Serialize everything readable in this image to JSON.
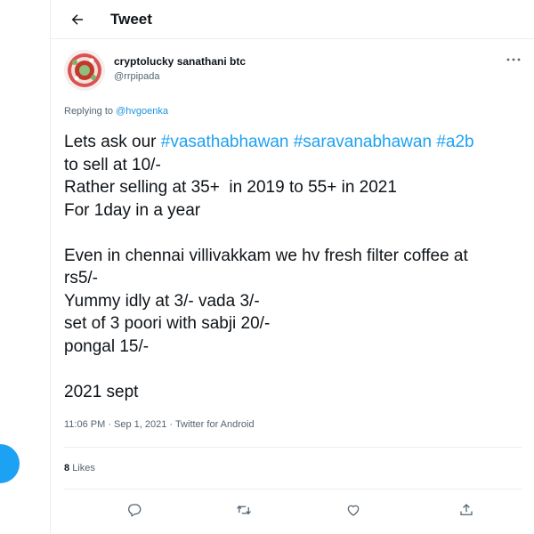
{
  "header": {
    "title": "Tweet"
  },
  "icons": {
    "back": "arrow-left-icon",
    "more": "more-dots-icon",
    "reply": "comment-icon",
    "retweet": "retweet-icon",
    "like": "heart-icon",
    "share": "share-icon"
  },
  "colors": {
    "accent": "#1da1f2",
    "link": "#1b95e0",
    "text": "#0f1419",
    "muted": "#536471",
    "border": "#ebeef0"
  },
  "tweet": {
    "author": {
      "display_name": "cryptolucky sanathani btc",
      "handle": "@rrpipada"
    },
    "replying_to": {
      "prefix": "Replying to",
      "handle": "@hvgoenka"
    },
    "lines": [
      {
        "parts": [
          {
            "text": "Lets ask our ",
            "hashtag": false
          },
          {
            "text": "#vasathabhawan",
            "hashtag": true
          },
          {
            "text": " ",
            "hashtag": false
          },
          {
            "text": "#saravanabhawan",
            "hashtag": true
          },
          {
            "text": " ",
            "hashtag": false
          },
          {
            "text": "#a2b",
            "hashtag": true
          }
        ]
      },
      {
        "parts": [
          {
            "text": "to sell at 10/-",
            "hashtag": false
          }
        ]
      },
      {
        "parts": [
          {
            "text": "Rather selling at 35+  in 2019 to 55+ in 2021",
            "hashtag": false
          }
        ]
      },
      {
        "parts": [
          {
            "text": "For 1day in a year",
            "hashtag": false
          }
        ]
      },
      {
        "parts": []
      },
      {
        "parts": [
          {
            "text": "Even in chennai villivakkam we hv fresh filter coffee at",
            "hashtag": false
          }
        ]
      },
      {
        "parts": [
          {
            "text": "rs5/-",
            "hashtag": false
          }
        ]
      },
      {
        "parts": [
          {
            "text": "Yummy idly at 3/- vada 3/-",
            "hashtag": false
          }
        ]
      },
      {
        "parts": [
          {
            "text": "set of 3 poori with sabji 20/-",
            "hashtag": false
          }
        ]
      },
      {
        "parts": [
          {
            "text": "pongal 15/-",
            "hashtag": false
          }
        ]
      },
      {
        "parts": []
      },
      {
        "parts": [
          {
            "text": "2021 sept",
            "hashtag": false
          }
        ]
      }
    ],
    "timestamp": "11:06 PM · Sep 1, 2021 · Twitter for Android",
    "likes": {
      "count": "8",
      "label": "Likes"
    }
  }
}
